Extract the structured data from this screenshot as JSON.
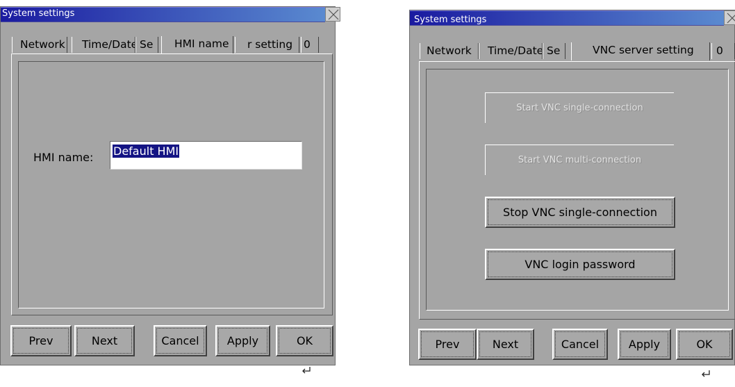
{
  "left_dialog": {
    "title": "System settings",
    "tabs": [
      "Network",
      "Time/Date",
      "Se",
      "HMI name",
      "r setting",
      "0"
    ],
    "active_tab": "HMI name",
    "hmi_name_label": "HMI name:",
    "hmi_name_value": "Default HMI",
    "buttons": {
      "prev": "Prev",
      "next": "Next",
      "cancel": "Cancel",
      "apply": "Apply",
      "ok": "OK"
    }
  },
  "right_dialog": {
    "title": "System settings",
    "tabs": [
      "Network",
      "Time/Date",
      "Se",
      "VNC server setting",
      "0"
    ],
    "active_tab": "VNC server setting",
    "vnc_buttons": {
      "start_single": "Start VNC single-connection",
      "start_multi": "Start VNC multi-connection",
      "stop_single": "Stop VNC single-connection",
      "login_password": "VNC login password"
    },
    "buttons": {
      "prev": "Prev",
      "next": "Next",
      "cancel": "Cancel",
      "apply": "Apply",
      "ok": "OK"
    }
  },
  "icons": {
    "close": "close-x-icon",
    "enter": "enter-return-icon"
  },
  "colors": {
    "dialog_bg": "#a5a5a5",
    "title_start": "#1a1aa0",
    "title_end": "#5a8ad0",
    "selection": "#141484"
  }
}
